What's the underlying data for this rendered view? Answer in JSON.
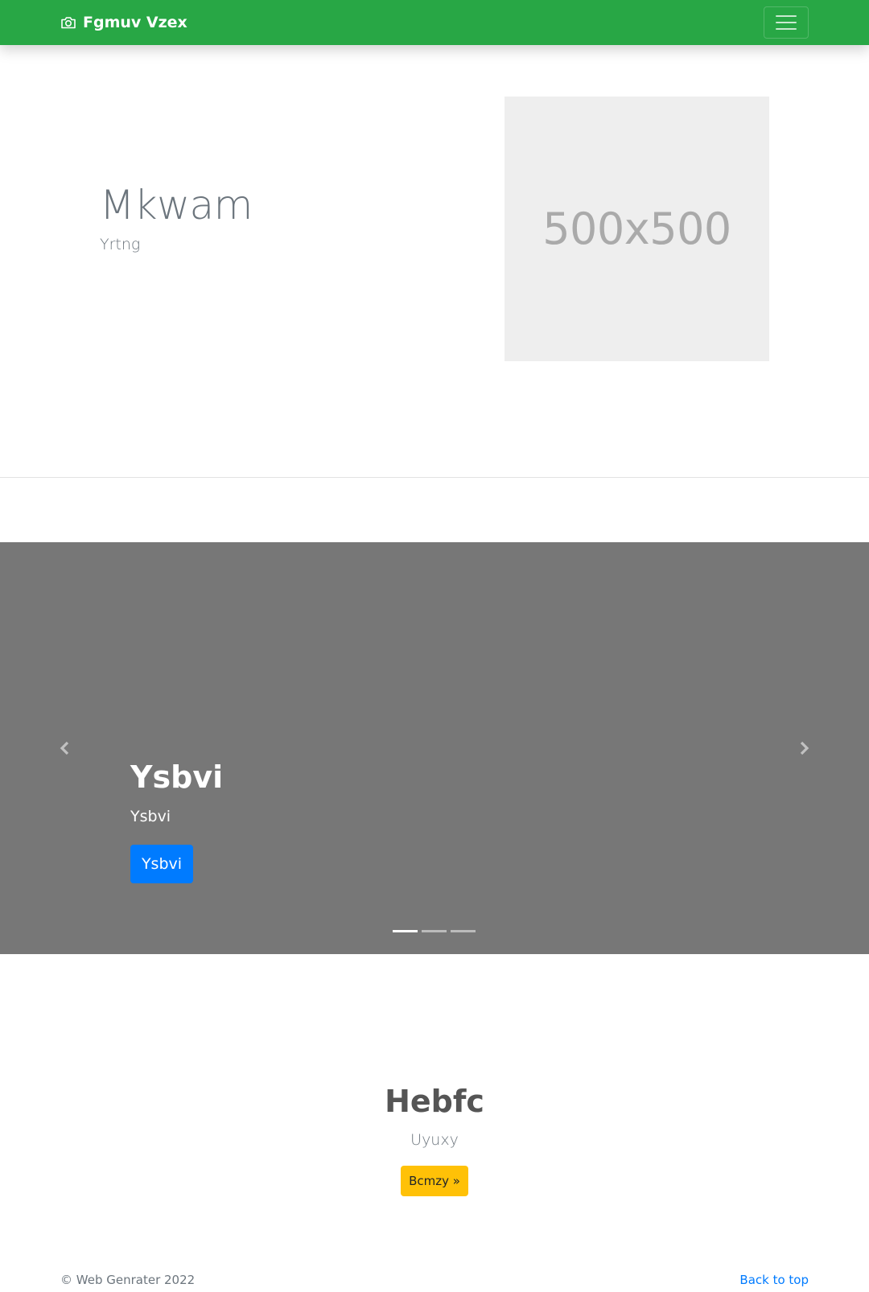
{
  "navbar": {
    "brand_name": "Fgmuv Vzex",
    "brand_icon": "camera-icon",
    "toggler_icon": "hamburger-icon",
    "background_color": "#28a745"
  },
  "hero": {
    "title": "Mkwam",
    "subtitle": "Yrtng",
    "image_placeholder_text": "500x500"
  },
  "carousel": {
    "slide_title": "Ysbvi",
    "slide_text": "Ysbvi",
    "slide_button_label": "Ysbvi",
    "prev_icon": "chevron-left-icon",
    "next_icon": "chevron-right-icon",
    "indicator_count": 3,
    "active_indicator": 0,
    "background_color": "#777777"
  },
  "feature": {
    "title": "Hebfc",
    "subtitle": "Uyuxy",
    "button_label": "Bcmzy »",
    "button_color": "#ffc107"
  },
  "footer": {
    "copyright": "© Web Genrater 2022",
    "back_to_top": "Back to top"
  }
}
